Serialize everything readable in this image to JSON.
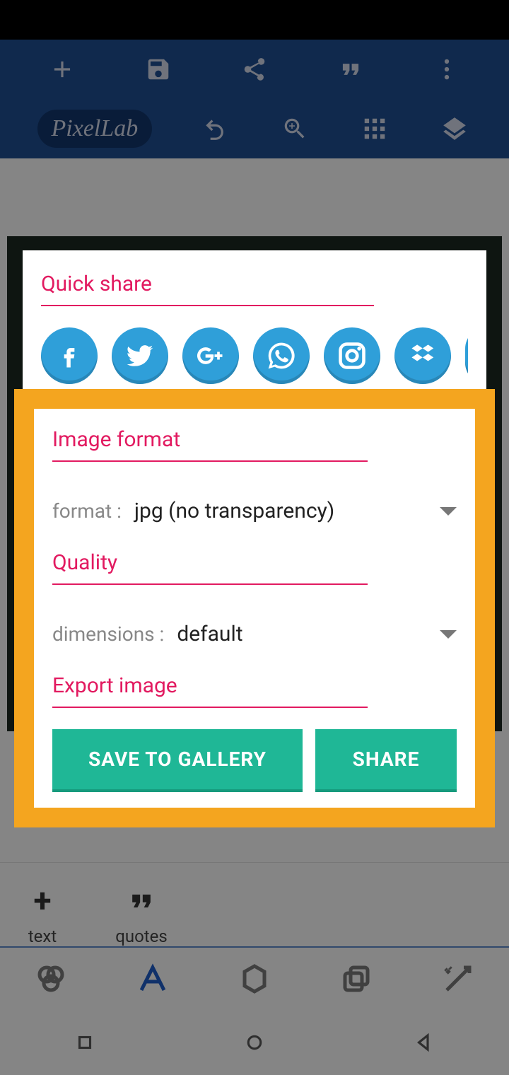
{
  "app": {
    "logo": "PixelLab"
  },
  "quickshare": {
    "title": "Quick share",
    "targets": [
      "facebook",
      "twitter",
      "google-plus",
      "whatsapp",
      "instagram",
      "dropbox"
    ]
  },
  "dialog": {
    "section_format": "Image format",
    "format_label": "format :",
    "format_value": "jpg (no transparency)",
    "section_quality": "Quality",
    "dimensions_label": "dimensions :",
    "dimensions_value": "default",
    "section_export": "Export image",
    "save_button": "SAVE TO GALLERY",
    "share_button": "SHARE"
  },
  "bottom": {
    "text_label": "text",
    "quotes_label": "quotes"
  }
}
